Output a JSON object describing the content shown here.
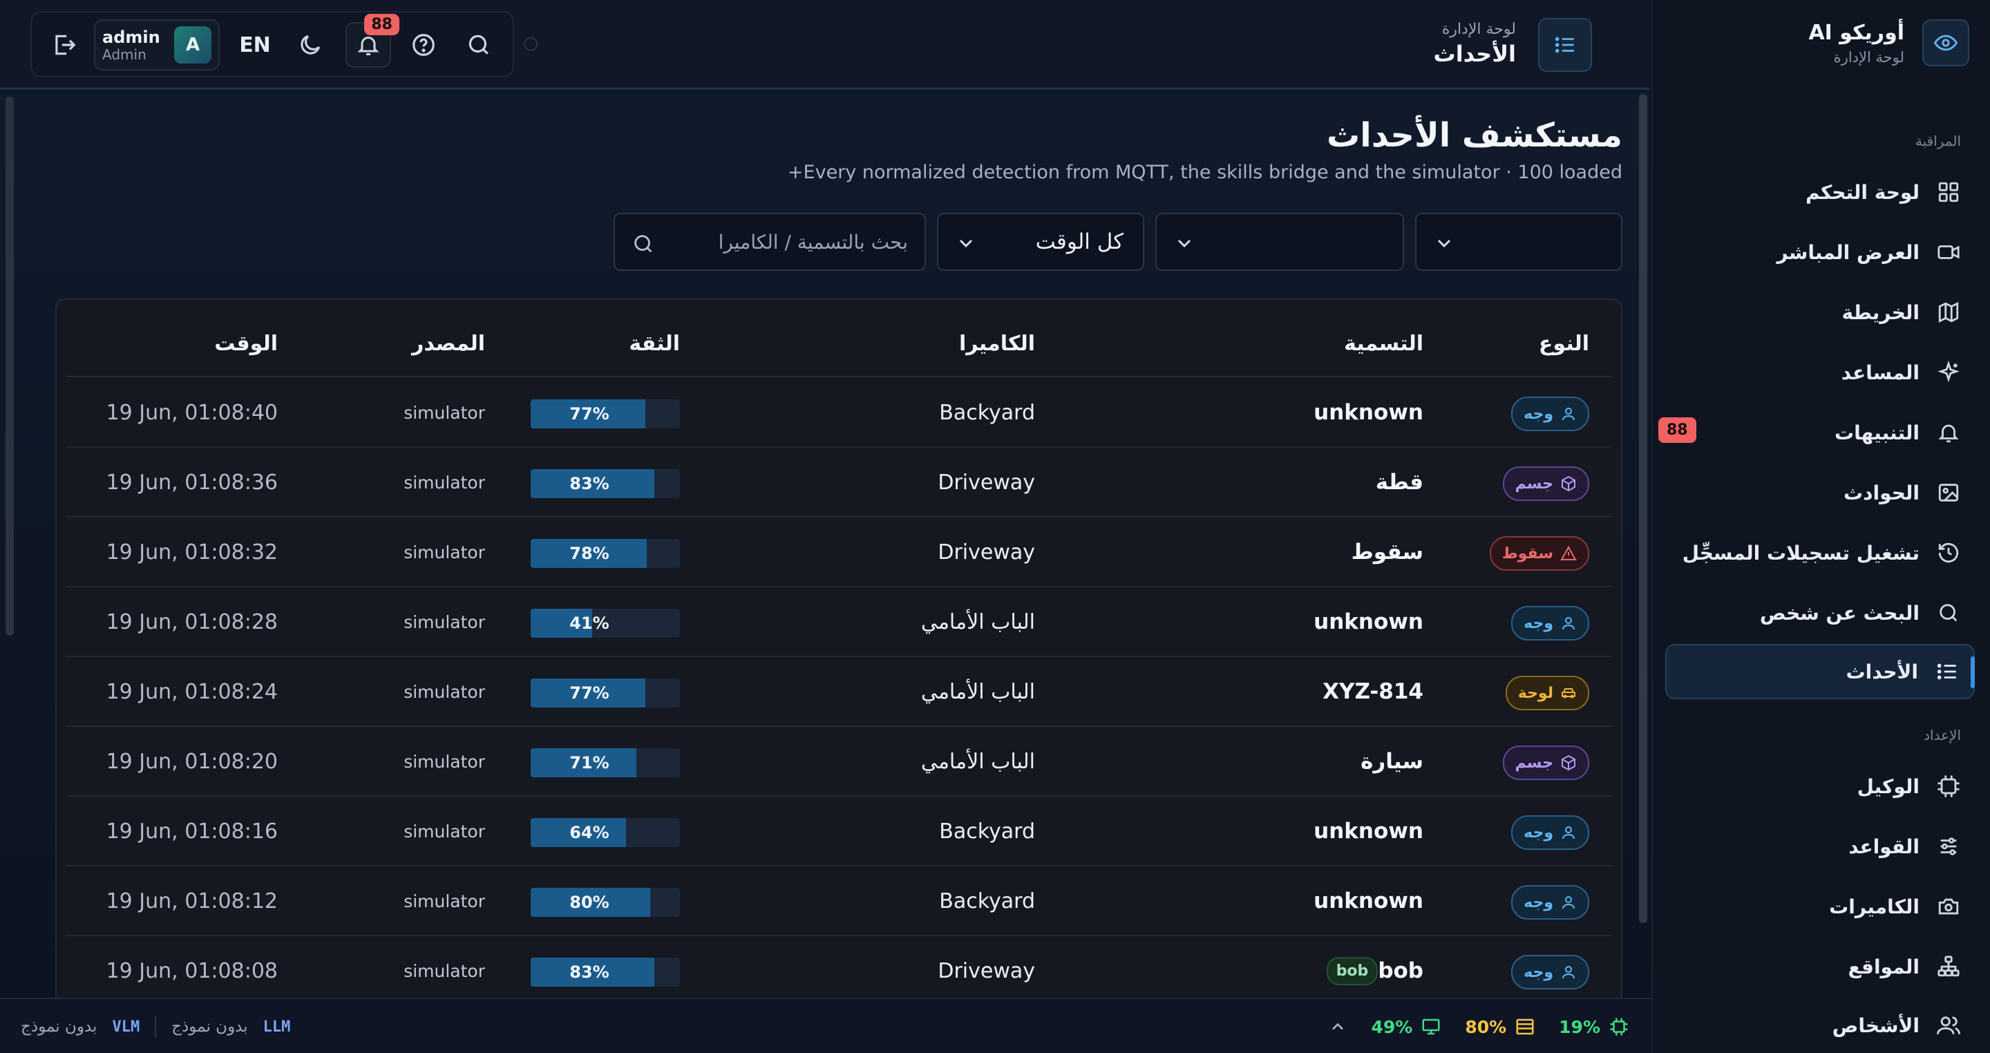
{
  "brand": {
    "name": "أوريكو AI",
    "subtitle": "لوحة الإدارة"
  },
  "sidebar": {
    "section_monitoring": "المراقبة",
    "section_setup": "الإعداد",
    "items": [
      {
        "label": "لوحة التحكم",
        "icon": "grid-icon"
      },
      {
        "label": "العرض المباشر",
        "icon": "video-icon"
      },
      {
        "label": "الخريطة",
        "icon": "map-icon"
      },
      {
        "label": "المساعد",
        "icon": "sparkles-icon"
      },
      {
        "label": "التنبيهات",
        "icon": "bell-icon",
        "badge": "88"
      },
      {
        "label": "الحوادث",
        "icon": "image-icon"
      },
      {
        "label": "تشغيل تسجيلات المسجِّل",
        "icon": "history-icon"
      },
      {
        "label": "البحث عن شخص",
        "icon": "search-icon"
      },
      {
        "label": "الأحداث",
        "icon": "list-icon",
        "active": true
      },
      {
        "label": "الوكيل",
        "icon": "cpu-icon"
      },
      {
        "label": "القواعد",
        "icon": "sliders-icon"
      },
      {
        "label": "الكاميرات",
        "icon": "camera-icon"
      },
      {
        "label": "المواقع",
        "icon": "sitemap-icon"
      },
      {
        "label": "الأشخاص",
        "icon": "users-icon"
      }
    ]
  },
  "header": {
    "breadcrumb": "لوحة الإدارة",
    "title": "الأحداث"
  },
  "toolbar": {
    "notifications_badge": "88",
    "language": "EN",
    "user": {
      "name": "admin",
      "role": "Admin",
      "initial": "A"
    }
  },
  "page": {
    "title": "مستكشف الأحداث",
    "subtitle": "Every normalized detection from MQTT, the skills bridge and the simulator · 100 loaded+"
  },
  "filters": {
    "type_value": "",
    "camera_value": "",
    "time_value": "كل الوقت",
    "search_placeholder": "بحث بالتسمية / الكاميرا"
  },
  "table": {
    "columns": {
      "type": "النوع",
      "label": "التسمية",
      "camera": "الكاميرا",
      "confidence": "الثقة",
      "source": "المصدر",
      "time": "الوقت"
    },
    "rows": [
      {
        "type": "وجه",
        "kind": "face",
        "label": "unknown",
        "camera": "Backyard",
        "confidence": 77,
        "confidence_text": "77%",
        "source": "simulator",
        "time": "19 Jun, 01:08:40"
      },
      {
        "type": "جسم",
        "kind": "body",
        "label": "قطة",
        "camera": "Driveway",
        "confidence": 83,
        "confidence_text": "83%",
        "source": "simulator",
        "time": "19 Jun, 01:08:36"
      },
      {
        "type": "سقوط",
        "kind": "fall",
        "label": "سقوط",
        "camera": "Driveway",
        "confidence": 78,
        "confidence_text": "78%",
        "source": "simulator",
        "time": "19 Jun, 01:08:32"
      },
      {
        "type": "وجه",
        "kind": "face",
        "label": "unknown",
        "camera": "الباب الأمامي",
        "confidence": 41,
        "confidence_text": "41%",
        "source": "simulator",
        "time": "19 Jun, 01:08:28"
      },
      {
        "type": "لوحة",
        "kind": "plate",
        "label": "XYZ-814",
        "camera": "الباب الأمامي",
        "confidence": 77,
        "confidence_text": "77%",
        "source": "simulator",
        "time": "19 Jun, 01:08:24"
      },
      {
        "type": "جسم",
        "kind": "body",
        "label": "سيارة",
        "camera": "الباب الأمامي",
        "confidence": 71,
        "confidence_text": "71%",
        "source": "simulator",
        "time": "19 Jun, 01:08:20"
      },
      {
        "type": "وجه",
        "kind": "face",
        "label": "unknown",
        "camera": "Backyard",
        "confidence": 64,
        "confidence_text": "64%",
        "source": "simulator",
        "time": "19 Jun, 01:08:16"
      },
      {
        "type": "وجه",
        "kind": "face",
        "label": "unknown",
        "camera": "Backyard",
        "confidence": 80,
        "confidence_text": "80%",
        "source": "simulator",
        "time": "19 Jun, 01:08:12"
      },
      {
        "type": "وجه",
        "kind": "face",
        "label": "bob",
        "tag": "bob",
        "camera": "Driveway",
        "confidence": 83,
        "confidence_text": "83%",
        "source": "simulator",
        "time": "19 Jun, 01:08:08"
      }
    ]
  },
  "statusbar": {
    "llm_tag": "LLM",
    "llm_value": "بدون نموذج",
    "vlm_tag": "VLM",
    "vlm_value": "بدون نموذج",
    "cpu": "19%",
    "memory": "80%",
    "display": "49%",
    "colors": {
      "cpu": "#3ddc84",
      "memory": "#f5c542",
      "display": "#3ddc84"
    }
  }
}
